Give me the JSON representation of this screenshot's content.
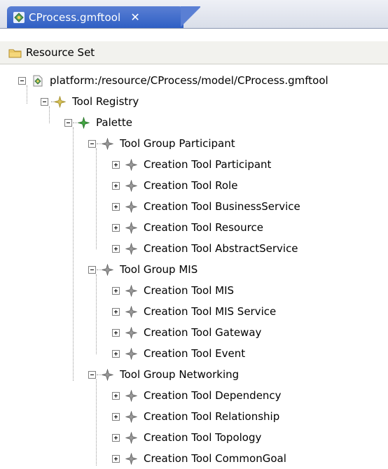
{
  "tab": {
    "title": "CProcess.gmftool",
    "close_glyph": "✕",
    "icon": "gmftool-file-icon"
  },
  "header": {
    "label": "Resource Set",
    "icon": "folder-icon"
  },
  "tree": {
    "root": {
      "label": "platform:/resource/CProcess/model/CProcess.gmftool",
      "icon": "gmftool-file-icon",
      "expanded": true
    },
    "registry": {
      "label": "Tool Registry",
      "expanded": true
    },
    "palette": {
      "label": "Palette",
      "expanded": true
    },
    "groups": [
      {
        "label": "Tool Group Participant",
        "expanded": true,
        "items": [
          "Creation Tool Participant",
          "Creation Tool Role",
          "Creation Tool BusinessService",
          "Creation Tool Resource",
          "Creation Tool AbstractService"
        ]
      },
      {
        "label": "Tool Group MIS",
        "expanded": true,
        "items": [
          "Creation Tool MIS",
          "Creation Tool MIS Service",
          "Creation Tool Gateway",
          "Creation Tool Event"
        ]
      },
      {
        "label": "Tool Group Networking",
        "expanded": true,
        "items": [
          "Creation Tool Dependency",
          "Creation Tool Relationship",
          "Creation Tool Topology",
          "Creation Tool CommonGoal"
        ]
      }
    ]
  },
  "colors": {
    "tab_blue": "#2f5fc4",
    "diamond_green": "#3e9a3e",
    "diamond_gray": "#8c8c8c",
    "diamond_yellow": "#c9b23a"
  }
}
